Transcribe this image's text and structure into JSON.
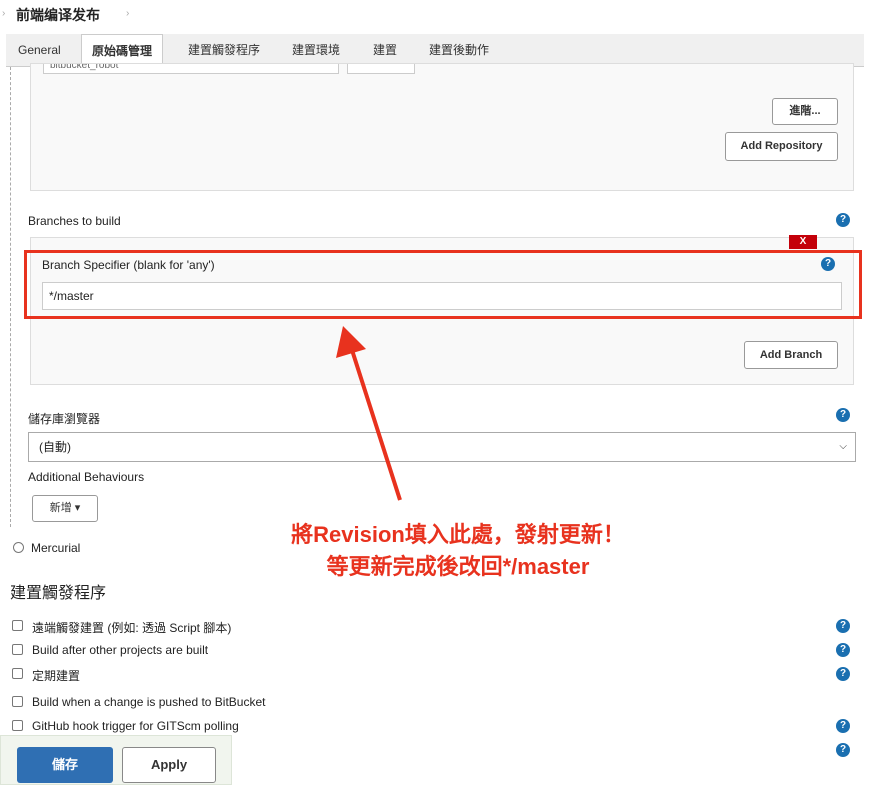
{
  "breadcrumb": {
    "title": "前端编译发布"
  },
  "tabs": [
    {
      "label": "General"
    },
    {
      "label": "原始碼管理"
    },
    {
      "label": "建置觸發程序"
    },
    {
      "label": "建置環境"
    },
    {
      "label": "建置"
    },
    {
      "label": "建置後動作"
    }
  ],
  "repository": {
    "credentials_value": "bitbucket_robot",
    "advanced_label": "進階...",
    "add_repository_label": "Add Repository"
  },
  "branches": {
    "heading": "Branches to build",
    "delete_label": "X",
    "specifier_label": "Branch Specifier (blank for 'any')",
    "specifier_value": "*/master",
    "add_branch_label": "Add Branch"
  },
  "repo_browser": {
    "label": "儲存庫瀏覽器",
    "selected": "(自動)"
  },
  "additional_behaviours": {
    "label": "Additional Behaviours",
    "add_label": "新增 ▾"
  },
  "scm_options": {
    "mercurial_label": "Mercurial"
  },
  "triggers": {
    "title": "建置觸發程序",
    "items": [
      {
        "label": "遠端觸發建置 (例如: 透過 Script 腳本)"
      },
      {
        "label": "Build after other projects are built"
      },
      {
        "label": "定期建置"
      },
      {
        "label": "Build when a change is pushed to BitBucket"
      },
      {
        "label": "GitHub hook trigger for GITScm polling"
      }
    ]
  },
  "annotation": {
    "line1": "將Revision填入此處，發射更新！",
    "line2": "等更新完成後改回*/master"
  },
  "footer": {
    "save_label": "儲存",
    "apply_label": "Apply"
  },
  "help_glyph": "?",
  "colors": {
    "accent_red": "#e8321e",
    "help_blue": "#1a6fb0",
    "save_blue": "#2f6fb3",
    "delete_red": "#c4000a"
  }
}
